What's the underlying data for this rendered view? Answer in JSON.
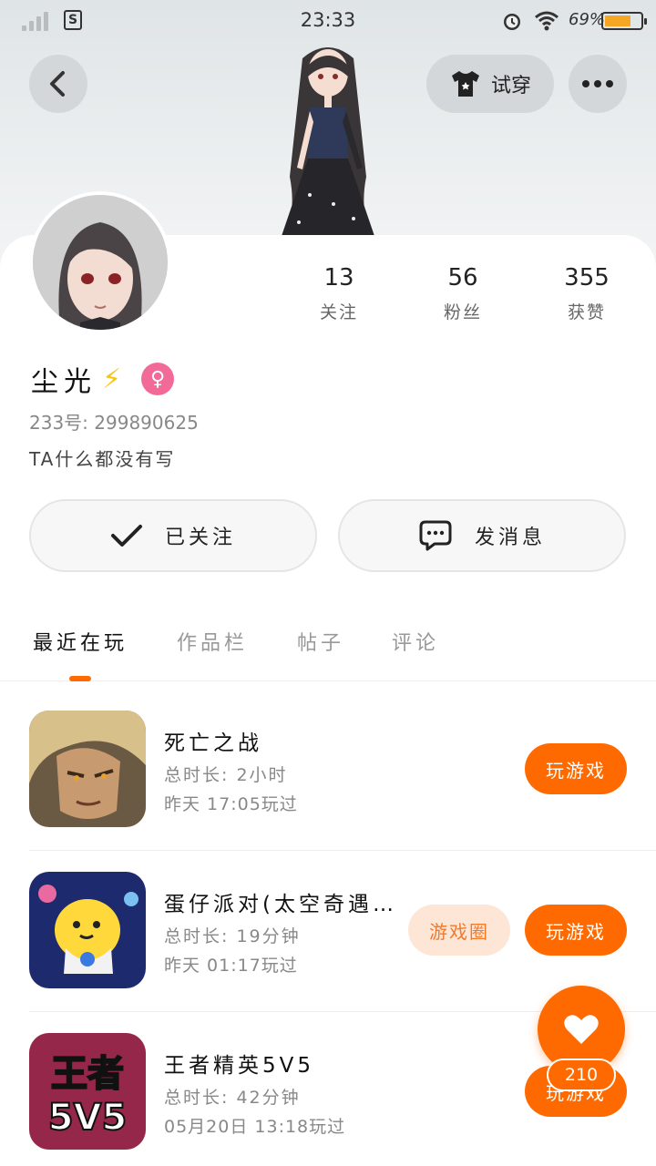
{
  "status_bar": {
    "time": "23:33",
    "battery_percent": "69%",
    "sim_label": "S",
    "battery_level": 0.69
  },
  "header": {
    "tryon_label": "试穿"
  },
  "profile": {
    "name": "尘光",
    "name_emoji": "⚡",
    "gender_symbol": "♀",
    "uid": "233号: 299890625",
    "bio": "TA什么都没有写",
    "stats": [
      {
        "value": "13",
        "label": "关注"
      },
      {
        "value": "56",
        "label": "粉丝"
      },
      {
        "value": "355",
        "label": "获赞"
      }
    ]
  },
  "actions": {
    "follow_label": "已关注",
    "message_label": "发消息"
  },
  "tabs": [
    "最近在玩",
    "作品栏",
    "帖子",
    "评论"
  ],
  "games": [
    {
      "title": "死亡之战",
      "duration": "总时长: 2小时",
      "last_played": "昨天 17:05玩过",
      "play_label": "玩游戏"
    },
    {
      "title": "蛋仔派对(太空奇遇…",
      "duration": "总时长: 19分钟",
      "last_played": "昨天 01:17玩过",
      "play_label": "玩游戏",
      "circle_label": "游戏圈"
    },
    {
      "title": "王者精英5V5",
      "duration": "总时长: 42分钟",
      "last_played": "05月20日 13:18玩过",
      "play_label": "玩游戏",
      "icon_text_1": "王者",
      "icon_text_2": "5V5"
    }
  ],
  "like": {
    "count": "210"
  },
  "colors": {
    "accent": "#ff6a00",
    "gender_pink": "#f26b98"
  }
}
